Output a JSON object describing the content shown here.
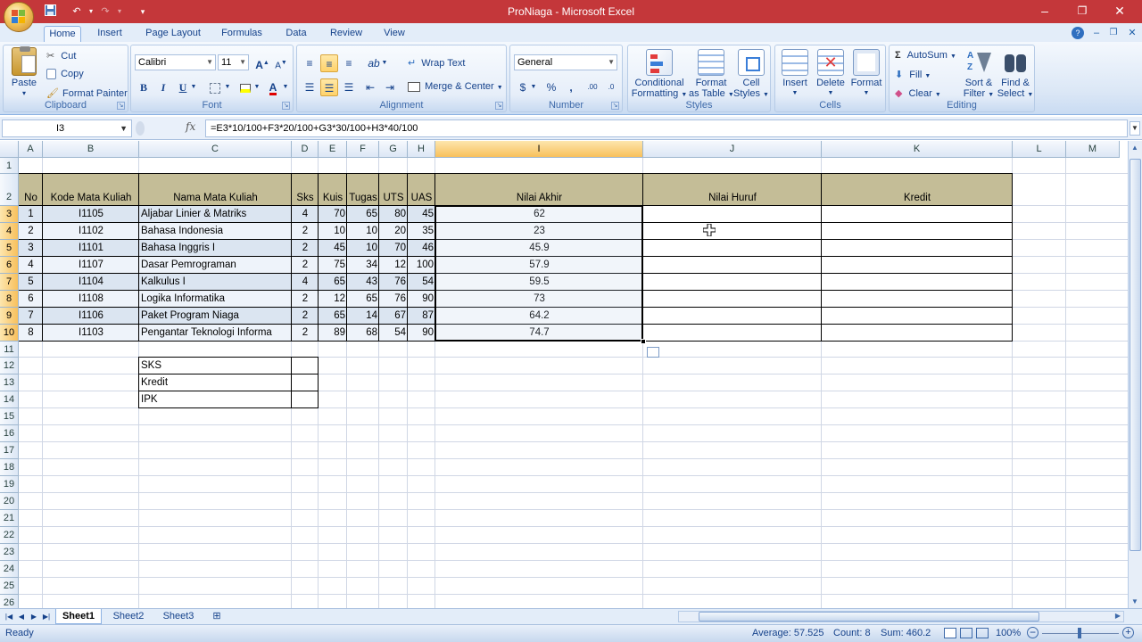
{
  "window": {
    "title": "ProNiaga - Microsoft Excel"
  },
  "qat": {
    "save": "save-icon",
    "undo": "↶",
    "redo": "↷",
    "customize": "▾"
  },
  "tabs": [
    "Home",
    "Insert",
    "Page Layout",
    "Formulas",
    "Data",
    "Review",
    "View"
  ],
  "ribbon": {
    "clipboard": {
      "label": "Clipboard",
      "paste": "Paste",
      "cut": "Cut",
      "copy": "Copy",
      "format_painter": "Format Painter"
    },
    "font": {
      "label": "Font",
      "name": "Calibri",
      "size": "11",
      "bold": "B",
      "italic": "I",
      "underline": "U",
      "grow": "A",
      "shrink": "A",
      "font_color": "A"
    },
    "alignment": {
      "label": "Alignment",
      "wrap": "Wrap Text",
      "merge": "Merge & Center"
    },
    "number": {
      "label": "Number",
      "format": "General",
      "currency": "$",
      "percent": "%",
      "comma": ",",
      "inc_dec": ".00",
      "dec_dec": ".0"
    },
    "styles": {
      "label": "Styles",
      "conditional": [
        "Conditional",
        "Formatting"
      ],
      "format_table": [
        "Format",
        "as Table"
      ],
      "cell_styles": [
        "Cell",
        "Styles"
      ]
    },
    "cells": {
      "label": "Cells",
      "insert": "Insert",
      "delete": "Delete",
      "format": "Format"
    },
    "editing": {
      "label": "Editing",
      "autosum": "AutoSum",
      "fill": "Fill",
      "clear": "Clear",
      "sort": [
        "Sort &",
        "Filter"
      ],
      "find": [
        "Find &",
        "Select"
      ]
    }
  },
  "formula_bar": {
    "name_box": "I3",
    "fx": "fx",
    "formula": "=E3*10/100+F3*20/100+G3*30/100+H3*40/100"
  },
  "columns": [
    "A",
    "B",
    "C",
    "D",
    "E",
    "F",
    "G",
    "H",
    "I",
    "J",
    "K",
    "L",
    "M"
  ],
  "rows": [
    "1",
    "2",
    "3",
    "4",
    "5",
    "6",
    "7",
    "8",
    "9",
    "10",
    "11",
    "12",
    "13",
    "14",
    "15",
    "16",
    "17",
    "18",
    "19",
    "20",
    "21",
    "22",
    "23",
    "24",
    "25",
    "26"
  ],
  "table": {
    "headers": [
      "No",
      "Kode Mata Kuliah",
      "Nama Mata Kuliah",
      "Sks",
      "Kuis",
      "Tugas",
      "UTS",
      "UAS",
      "Nilai Akhir",
      "Nilai Huruf",
      "Kredit"
    ],
    "rows": [
      [
        "1",
        "I1105",
        "Aljabar Linier & Matriks",
        "4",
        "70",
        "65",
        "80",
        "45",
        "62"
      ],
      [
        "2",
        "I1102",
        "Bahasa Indonesia",
        "2",
        "10",
        "10",
        "20",
        "35",
        "23"
      ],
      [
        "3",
        "I1101",
        "Bahasa Inggris I",
        "2",
        "45",
        "10",
        "70",
        "46",
        "45.9"
      ],
      [
        "4",
        "I1107",
        "Dasar Pemrograman",
        "2",
        "75",
        "34",
        "12",
        "100",
        "57.9"
      ],
      [
        "5",
        "I1104",
        "Kalkulus I",
        "4",
        "65",
        "43",
        "76",
        "54",
        "59.5"
      ],
      [
        "6",
        "I1108",
        "Logika Informatika",
        "2",
        "12",
        "65",
        "76",
        "90",
        "73"
      ],
      [
        "7",
        "I1106",
        "Paket Program Niaga",
        "2",
        "65",
        "14",
        "67",
        "87",
        "64.2"
      ],
      [
        "8",
        "I1103",
        "Pengantar Teknologi Informa",
        "2",
        "89",
        "68",
        "54",
        "90",
        "74.7"
      ]
    ]
  },
  "summary": [
    "SKS",
    "Kredit",
    "IPK"
  ],
  "sheets": [
    "Sheet1",
    "Sheet2",
    "Sheet3"
  ],
  "status": {
    "ready": "Ready",
    "average": "Average: 57.525",
    "count": "Count: 8",
    "sum": "Sum: 460.2",
    "zoom": "100%"
  },
  "colors": {
    "title_bar": "#c4373a",
    "header_band": "#c4bd97",
    "row_band": "#dbe5f1",
    "selection_header": "#f8c05c"
  }
}
